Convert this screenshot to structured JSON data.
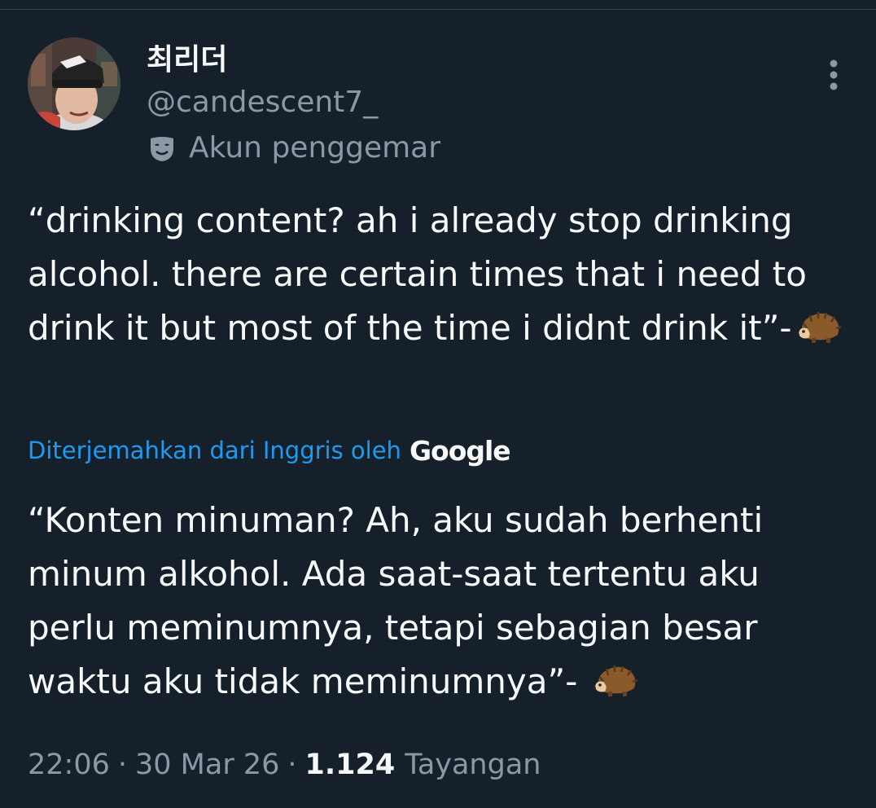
{
  "author": {
    "name": "최리더",
    "handle": "@candescent7_",
    "account_label": "Akun penggemar",
    "avatar_icon": "profile-photo-avatar",
    "account_icon": "mask-icon"
  },
  "tweet": {
    "original_text": "“drinking content? ah i already stop drinking alcohol. there are certain times that i need to drink it but most of the time i didnt drink it”-",
    "translation_label": "Diterjemahkan dari Inggris oleh",
    "translation_provider": "Google",
    "translated_text": "“Konten minuman? Ah, aku sudah berhenti minum alkohol. Ada saat-saat tertentu aku perlu meminumnya, tetapi sebagian besar waktu aku tidak meminumnya”- ",
    "emoji_icon": "hedgehog-icon"
  },
  "meta": {
    "time": "22:06",
    "separator": "·",
    "date": "30 Mar 26",
    "views_count": "1.124",
    "views_label": "Tayangan"
  },
  "colors": {
    "background": "#15202b",
    "primary_text": "#f7f9f9",
    "secondary_text": "#8b98a5",
    "link": "#1d9bf0"
  }
}
